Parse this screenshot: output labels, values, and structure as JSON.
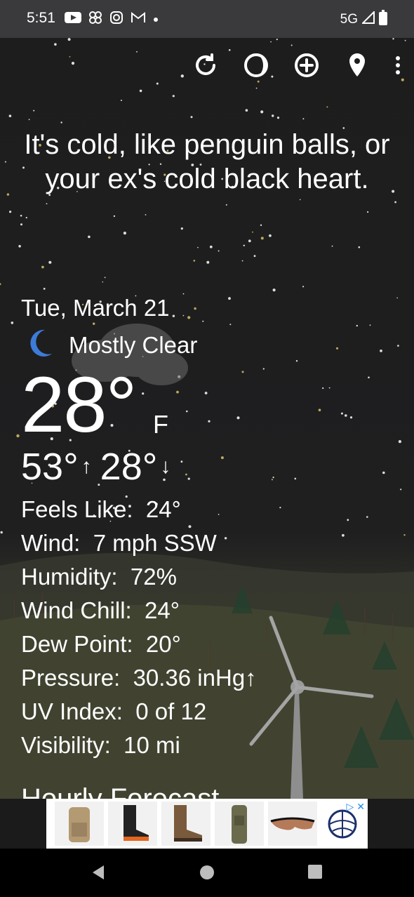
{
  "status_bar": {
    "time": "5:51",
    "network": "5G",
    "notification_icons": [
      "youtube-icon",
      "pinwheel-icon",
      "instagram-icon",
      "gmail-icon",
      "dot-icon"
    ]
  },
  "toolbar": {
    "buttons": [
      "refresh-icon",
      "moon-phase-icon",
      "add-location-icon",
      "location-pin-icon",
      "more-options-icon"
    ]
  },
  "quip": "It's cold, like penguin balls, or your ex's cold black heart.",
  "weather": {
    "date": "Tue, March 21",
    "condition": "Mostly Clear",
    "temperature": "28°",
    "unit": "F",
    "high": "53°",
    "low": "28°",
    "details": [
      {
        "label": "Feels Like:",
        "value": "24°"
      },
      {
        "label": "Wind:",
        "value": "7 mph SSW"
      },
      {
        "label": "Humidity:",
        "value": "72%"
      },
      {
        "label": "Wind Chill:",
        "value": "24°"
      },
      {
        "label": "Dew Point:",
        "value": "20°"
      },
      {
        "label": "Pressure:",
        "value": "30.36 inHg↑"
      },
      {
        "label": "UV Index:",
        "value": "0 of 12"
      },
      {
        "label": "Visibility:",
        "value": "10 mi"
      }
    ]
  },
  "hourly_forecast_title": "Hourly Forecast",
  "ad": {
    "items": [
      "backpack",
      "boots-black",
      "boots-brown",
      "tactical-pack",
      "sunglasses"
    ]
  },
  "nav": [
    "back-icon",
    "home-icon",
    "recents-icon"
  ]
}
